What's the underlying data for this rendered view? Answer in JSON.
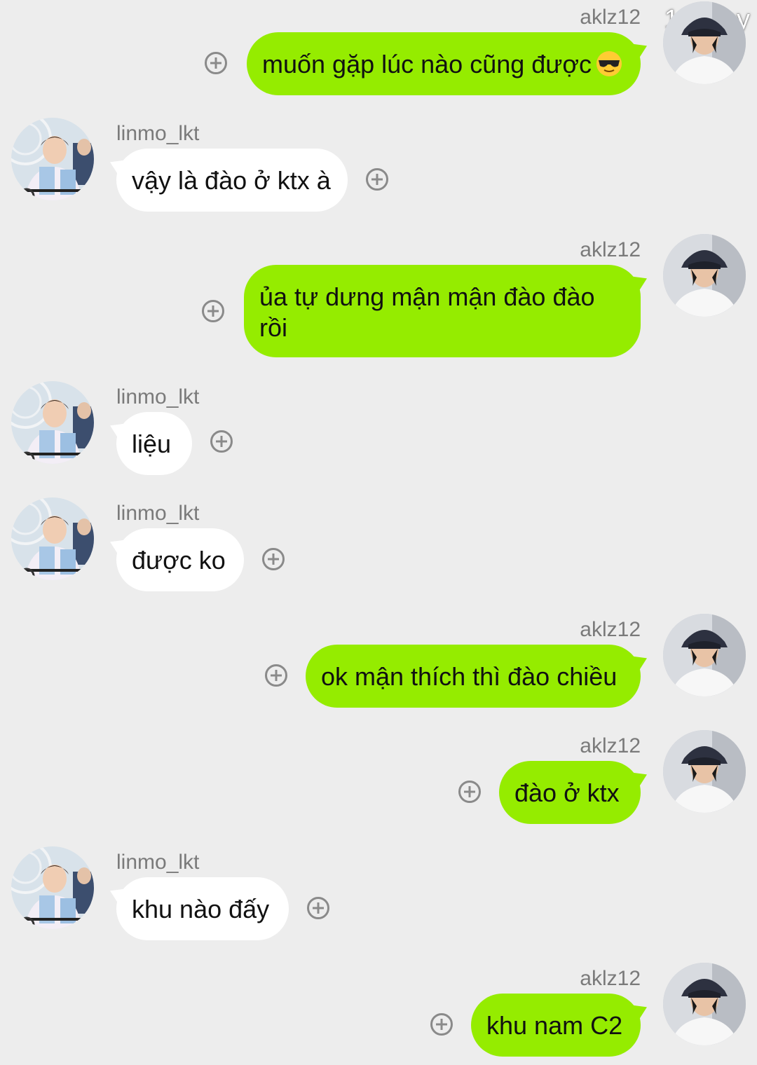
{
  "watermark": "134 joy",
  "colors": {
    "background": "#ededed",
    "my_bubble": "#95ec00",
    "their_bubble": "#ffffff"
  },
  "messages": [
    {
      "sender": "aklz12",
      "text": "muốn gặp lúc nào cũng được",
      "emoji": "sunglasses-emoji"
    },
    {
      "sender": "linmo_lkt",
      "text": "vậy là đào ở ktx à"
    },
    {
      "sender": "aklz12",
      "text": "ủa tự dưng mận mận đào đào rồi"
    },
    {
      "sender": "linmo_lkt",
      "text": "liệu"
    },
    {
      "sender": "linmo_lkt",
      "text": "được ko"
    },
    {
      "sender": "aklz12",
      "text": "ok mận thích thì đào chiều"
    },
    {
      "sender": "aklz12",
      "text": "đào ở ktx"
    },
    {
      "sender": "linmo_lkt",
      "text": "khu nào đấy"
    },
    {
      "sender": "aklz12",
      "text": "khu nam C2"
    }
  ]
}
